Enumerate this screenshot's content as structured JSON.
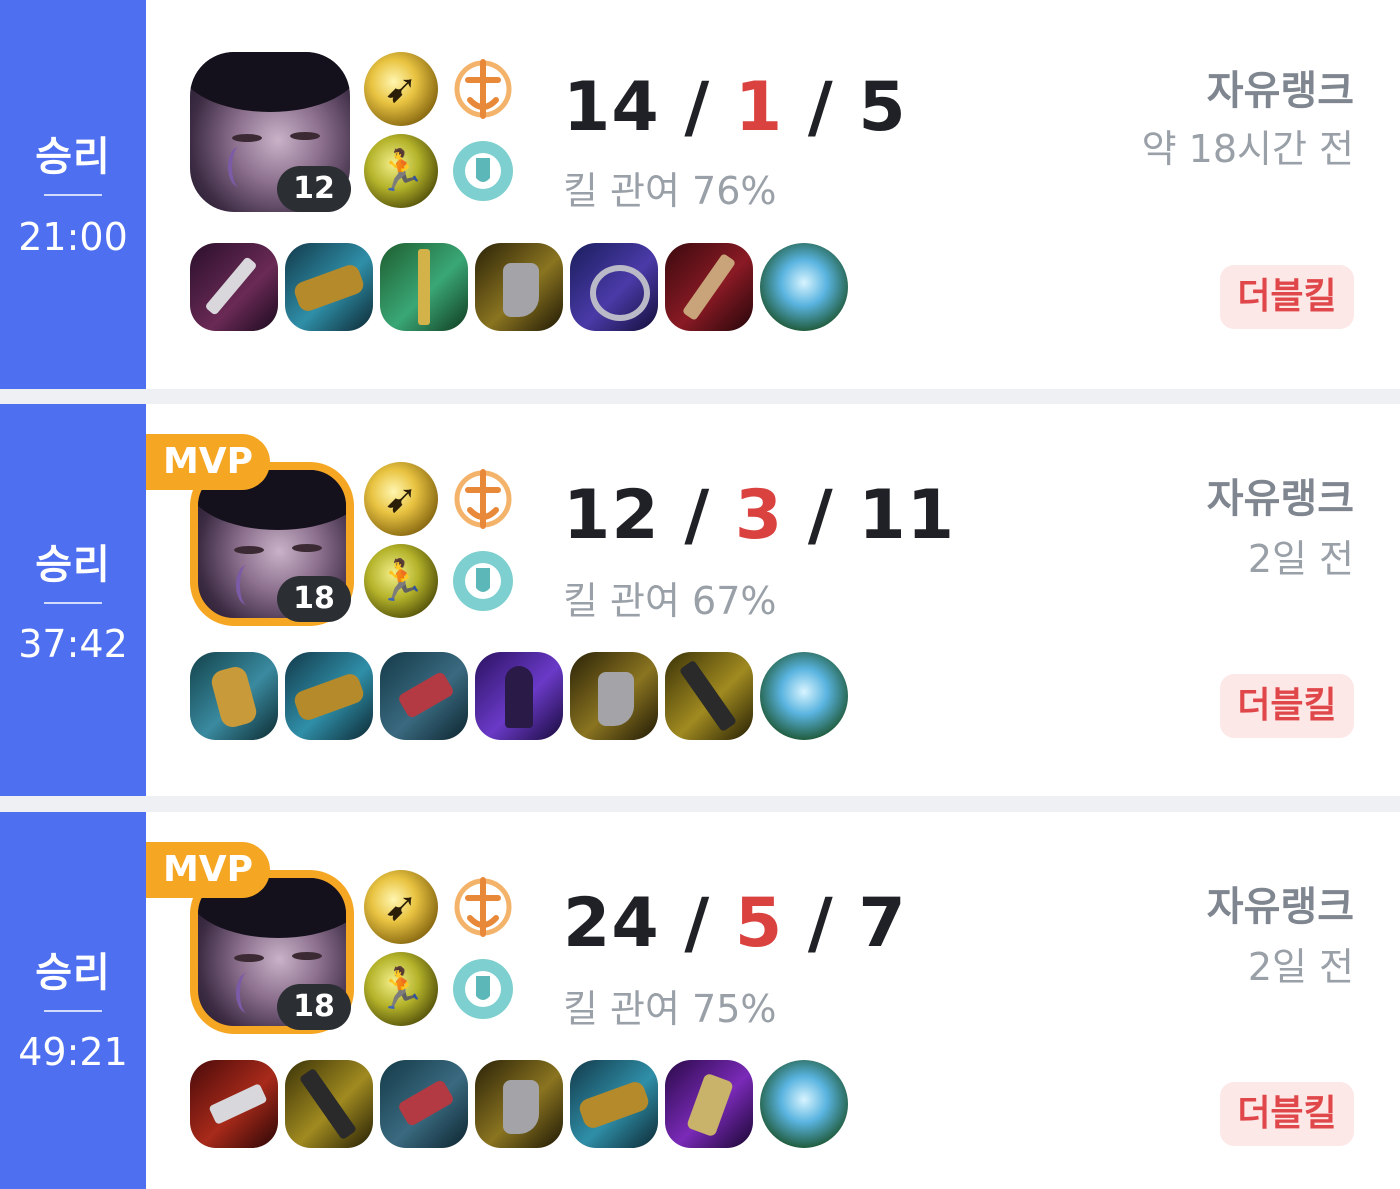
{
  "matches": [
    {
      "result": "승리",
      "duration": "21:00",
      "champion": "portrait-champion",
      "level": "12",
      "mvp": "",
      "spells": [
        "flash-icon",
        "ghost-icon"
      ],
      "runes": [
        "lethal-tempo-icon",
        "resolve-secondary-icon"
      ],
      "kills": "14",
      "deaths": "1",
      "assists": "5",
      "separator": "/",
      "kill_participation": "킬 관여 76%",
      "queue": "자유랭크",
      "time_ago": "약 18시간 전",
      "multikill": "더블킬",
      "items": [
        "dagger-icon",
        "cannon-icon",
        "sword-icon",
        "boots-icon",
        "axe-icon",
        "blade-icon",
        "ward-orb-icon"
      ]
    },
    {
      "result": "승리",
      "duration": "37:42",
      "champion": "portrait-champion",
      "level": "18",
      "mvp": "MVP",
      "spells": [
        "flash-icon",
        "ghost-icon"
      ],
      "runes": [
        "lethal-tempo-icon",
        "resolve-secondary-icon"
      ],
      "kills": "12",
      "deaths": "3",
      "assists": "11",
      "separator": "/",
      "kill_participation": "킬 관여 67%",
      "queue": "자유랭크",
      "time_ago": "2일 전",
      "multikill": "더블킬",
      "items": [
        "quiver-icon",
        "cannon-icon",
        "claw-icon",
        "shadow-icon",
        "boots-icon",
        "runic-blade-icon",
        "ward-orb-icon"
      ]
    },
    {
      "result": "승리",
      "duration": "49:21",
      "champion": "portrait-champion",
      "level": "18",
      "mvp": "MVP",
      "spells": [
        "flash-icon",
        "ghost-icon"
      ],
      "runes": [
        "lethal-tempo-icon",
        "resolve-secondary-icon"
      ],
      "kills": "24",
      "deaths": "5",
      "assists": "7",
      "separator": "/",
      "kill_participation": "킬 관여 75%",
      "queue": "자유랭크",
      "time_ago": "2일 전",
      "multikill": "더블킬",
      "items": [
        "serrated-blade-icon",
        "runic-blade-icon",
        "claw-icon",
        "boots-icon",
        "cannon-icon",
        "void-blade-icon",
        "ward-orb-icon"
      ]
    }
  ],
  "colors": {
    "win": "#4e6ff0",
    "mvp": "#f5a623",
    "deaths": "#d9423f",
    "multikill_bg": "#fde8e8",
    "multikill_text": "#e0474a"
  }
}
